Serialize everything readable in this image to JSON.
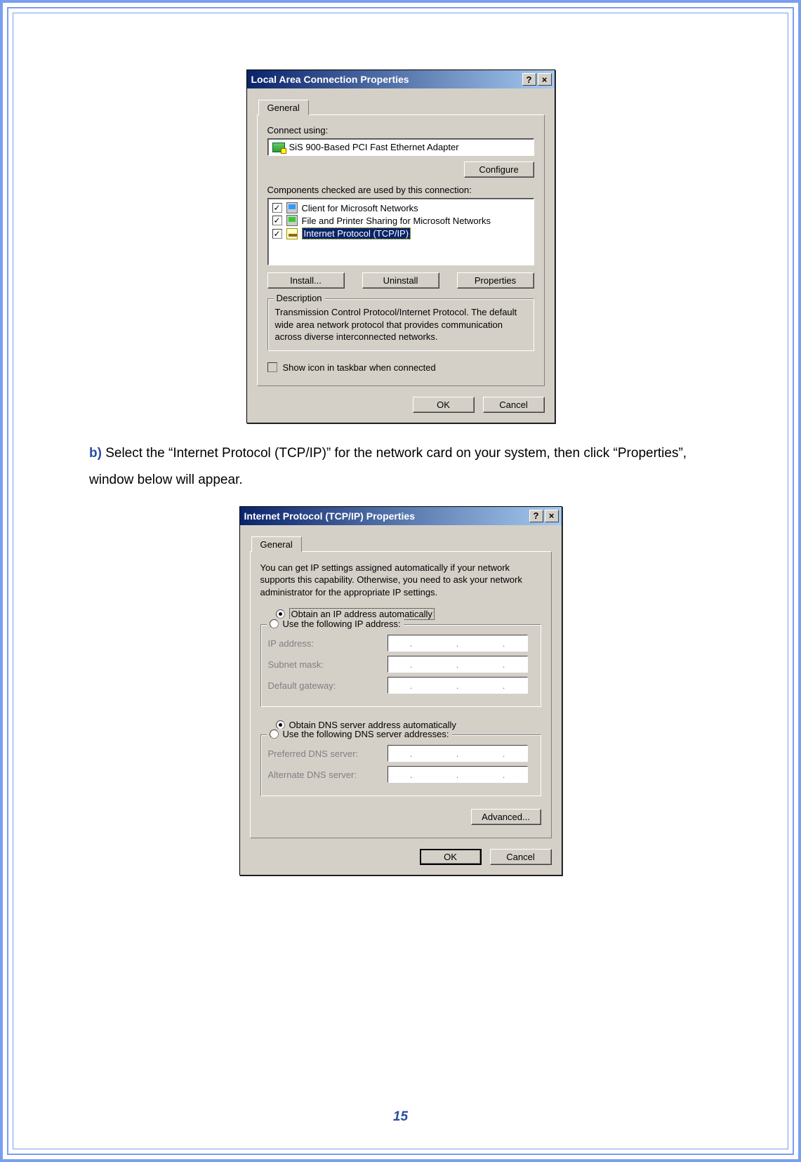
{
  "dialog1": {
    "title": "Local Area Connection Properties",
    "tab": "General",
    "connect_label": "Connect using:",
    "adapter": "SiS 900-Based PCI Fast Ethernet Adapter",
    "configure_btn": "Configure",
    "components_label": "Components checked are used by this connection:",
    "components": [
      {
        "label": "Client for Microsoft Networks",
        "checked": true,
        "selected": false,
        "icon": "client"
      },
      {
        "label": "File and Printer Sharing for Microsoft Networks",
        "checked": true,
        "selected": false,
        "icon": "share"
      },
      {
        "label": "Internet Protocol (TCP/IP)",
        "checked": true,
        "selected": true,
        "icon": "proto"
      }
    ],
    "install_btn": "Install...",
    "uninstall_btn": "Uninstall",
    "properties_btn": "Properties",
    "desc_legend": "Description",
    "desc_text": "Transmission Control Protocol/Internet Protocol. The default wide area network protocol that provides communication across diverse interconnected networks.",
    "show_icon": "Show icon in taskbar when connected",
    "ok_btn": "OK",
    "cancel_btn": "Cancel"
  },
  "instruction": {
    "step": "b)",
    "text": " Select the “Internet Protocol (TCP/IP)” for the network card on your system, then click “Properties”, window below will appear."
  },
  "dialog2": {
    "title": "Internet Protocol (TCP/IP) Properties",
    "tab": "General",
    "intro": "You can get IP settings assigned automatically if your network supports this capability. Otherwise, you need to ask your network administrator for the appropriate IP settings.",
    "radio_obtain_ip": "Obtain an IP address automatically",
    "radio_use_ip": "Use the following IP address:",
    "ip_label": "IP address:",
    "subnet_label": "Subnet mask:",
    "gateway_label": "Default gateway:",
    "radio_obtain_dns": "Obtain DNS server address automatically",
    "radio_use_dns": "Use the following DNS server addresses:",
    "pref_dns_label": "Preferred DNS server:",
    "alt_dns_label": "Alternate DNS server:",
    "advanced_btn": "Advanced...",
    "ok_btn": "OK",
    "cancel_btn": "Cancel"
  },
  "page_number": "15"
}
